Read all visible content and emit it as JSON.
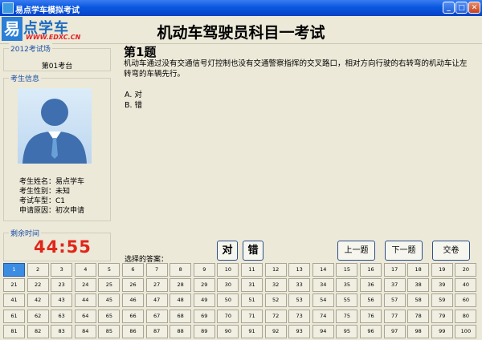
{
  "window": {
    "title": "易点学车模拟考试"
  },
  "logo": {
    "brand": "易点学车",
    "icon_char": "易",
    "url": "WWW.EDXC.CN"
  },
  "header": {
    "exam_title": "机动车驾驶员科目一考试"
  },
  "venue": {
    "legend": "2012考试场",
    "seat": "第01考台"
  },
  "examinee": {
    "legend": "考生信息",
    "rows": [
      "考生姓名：易点学车",
      "考生性别：未知",
      "考试车型：C1",
      "申请原因：初次申请"
    ]
  },
  "timer": {
    "legend": "剩余时间",
    "value": "44:55"
  },
  "question": {
    "title": "第1题",
    "text": "机动车通过没有交通信号灯控制也没有交通警察指挥的交叉路口，相对方向行驶的右转弯的机动车让左转弯的车辆先行。",
    "options": [
      "A. 对",
      "B. 错"
    ]
  },
  "answer": {
    "label": "选择的答案：",
    "true_label": "对",
    "false_label": "错"
  },
  "nav": {
    "prev": "上一题",
    "next": "下一题",
    "submit": "交卷"
  },
  "question_grid": {
    "count": 100,
    "current": 1,
    "columns": 20
  }
}
